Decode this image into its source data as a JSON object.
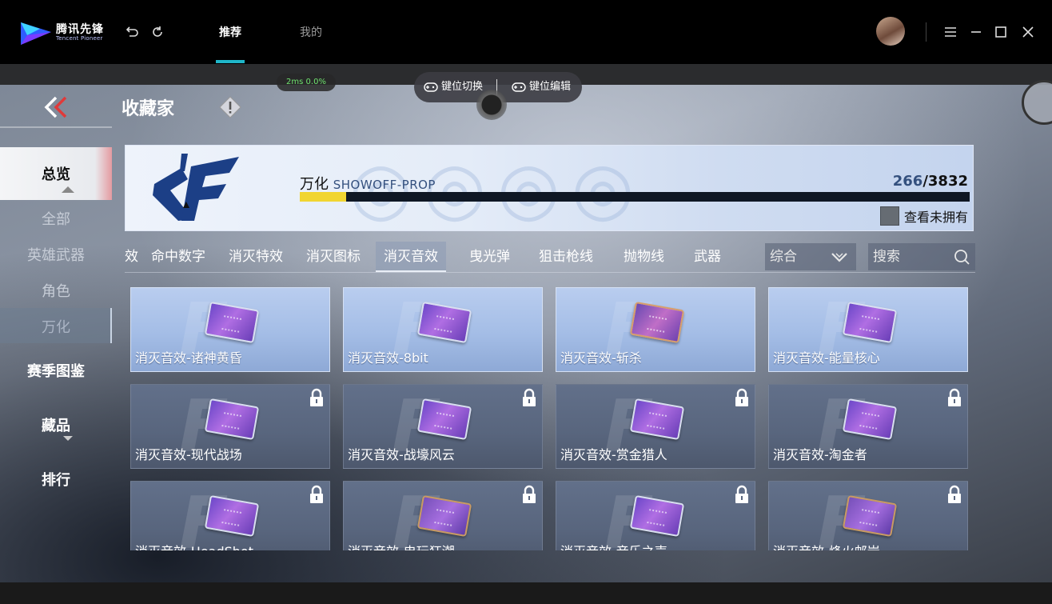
{
  "app": {
    "logo_cn": "腾讯先锋",
    "logo_en": "Tencent Pioneer",
    "tabs": [
      {
        "label": "推荐",
        "active": true
      },
      {
        "label": "我的",
        "active": false
      }
    ],
    "accent": "#1fb6c9"
  },
  "overlay": {
    "latency": "2ms",
    "loss": "0.0%",
    "key_switch": "键位切换",
    "key_edit": "键位编辑"
  },
  "game": {
    "title": "收藏家",
    "nav": {
      "overview": "总览",
      "all": "全部",
      "hero_weapons": "英雄武器",
      "characters": "角色",
      "wanhua": "万化",
      "season": "赛季图鉴",
      "collection": "藏品",
      "ranking": "排行"
    },
    "banner": {
      "title_cn": "万化",
      "title_en": "SHOWOFF-PROP",
      "owned": "266",
      "total": "/3832",
      "progress": 0.0694,
      "show_unowned": "查看未拥有"
    },
    "filters": [
      {
        "label": "效",
        "active": false
      },
      {
        "label": "命中数字",
        "active": false
      },
      {
        "label": "消灭特效",
        "active": false
      },
      {
        "label": "消灭图标",
        "active": false
      },
      {
        "label": "消灭音效",
        "active": true
      },
      {
        "label": "曳光弹",
        "active": false
      },
      {
        "label": "狙击枪线",
        "active": false
      },
      {
        "label": "抛物线",
        "active": false
      },
      {
        "label": "武器",
        "active": false
      }
    ],
    "sort": "综合",
    "search_placeholder": "搜索",
    "cards": [
      {
        "name": "消灭音效-诸神黄昏",
        "locked": false,
        "tint": "normal"
      },
      {
        "name": "消灭音效-8bit",
        "locked": false,
        "tint": "normal"
      },
      {
        "name": "消灭音效-斩杀",
        "locked": false,
        "tint": "copper"
      },
      {
        "name": "消灭音效-能量核心",
        "locked": false,
        "tint": "normal"
      },
      {
        "name": "消灭音效-现代战场",
        "locked": true,
        "tint": "normal"
      },
      {
        "name": "消灭音效-战壕风云",
        "locked": true,
        "tint": "normal"
      },
      {
        "name": "消灭音效-赏金猎人",
        "locked": true,
        "tint": "normal"
      },
      {
        "name": "消灭音效-淘金者",
        "locked": true,
        "tint": "normal"
      },
      {
        "name": "消灭音效-HeadShot",
        "locked": true,
        "tint": "normal"
      },
      {
        "name": "消灭音效-电玩狂潮",
        "locked": true,
        "tint": "orange"
      },
      {
        "name": "消灭音效-音乐之声",
        "locked": true,
        "tint": "normal"
      },
      {
        "name": "消灭音效-烽火邮岩",
        "locked": true,
        "tint": "orange"
      }
    ]
  }
}
